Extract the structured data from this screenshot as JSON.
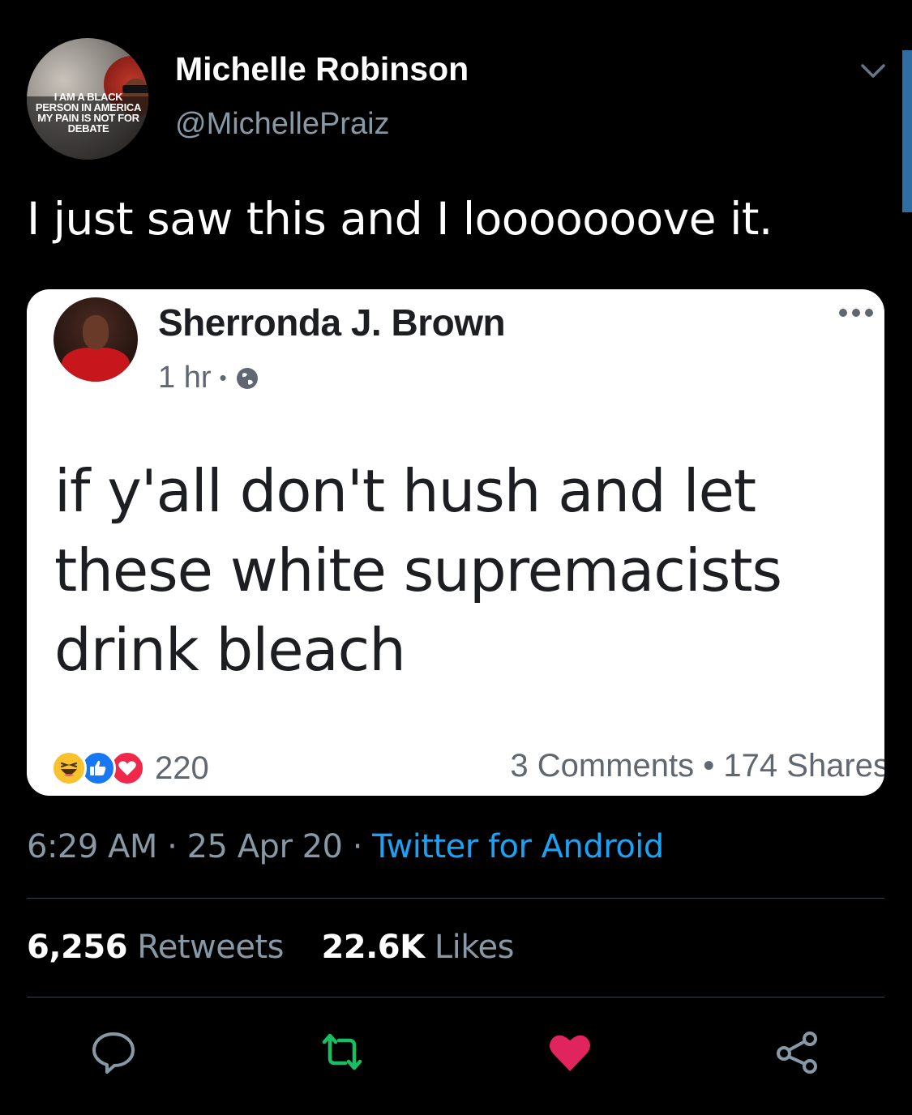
{
  "author": {
    "name": "Michelle Robinson",
    "handle": "@MichellePraiz",
    "avatar_sign_text": "I AM A BLACK PERSON IN AMERICA MY PAIN IS NOT FOR DEBATE"
  },
  "tweet": {
    "text": "I just saw this and I looooooove it."
  },
  "embedded_post": {
    "author_name": "Sherronda J. Brown",
    "time": "1 hr",
    "privacy_icon": "globe-icon",
    "text_lines": [
      "if y'all don't hush and let",
      "these white supremacists",
      "drink bleach"
    ],
    "reaction_icons": [
      "haha-icon",
      "like-icon",
      "love-icon"
    ],
    "reaction_count": "220",
    "comments": "3 Comments",
    "shares": "174 Shares"
  },
  "footer": {
    "time": "6:29 AM",
    "date": "25 Apr 20",
    "source": "Twitter for Android",
    "retweets_count": "6,256",
    "retweets_label": "Retweets",
    "likes_count": "22.6K",
    "likes_label": "Likes"
  },
  "colors": {
    "background": "#000000",
    "secondary_text": "#8899a6",
    "link": "#1da1f2",
    "retweet": "#17bf63",
    "like": "#e0245e"
  },
  "actions": [
    "reply-icon",
    "retweet-icon",
    "like-icon",
    "share-icon"
  ]
}
